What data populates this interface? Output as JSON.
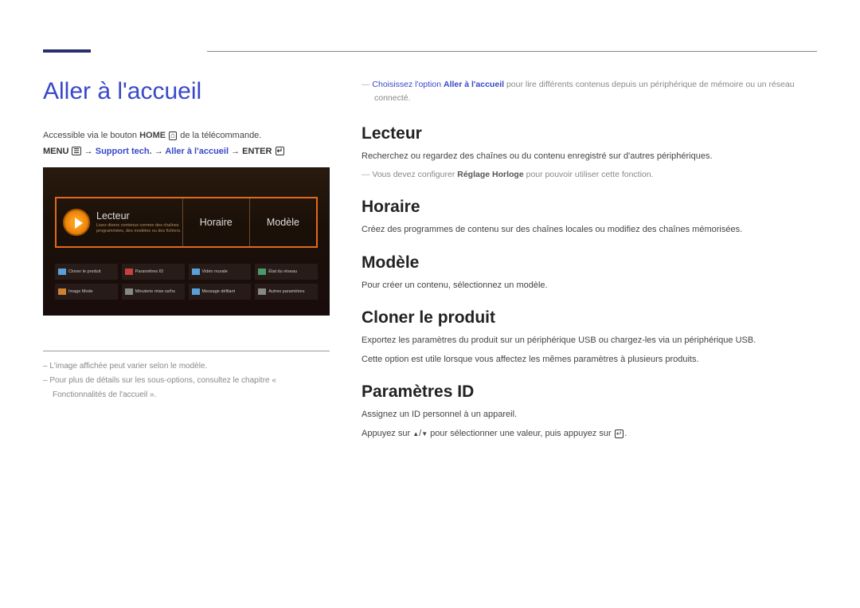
{
  "page": {
    "title": "Aller à l'accueil",
    "accessible_text_pre": "Accessible via le bouton ",
    "accessible_text_home": "HOME",
    "accessible_text_post": " de la télécommande.",
    "menu_path": {
      "menu": "MENU",
      "p2": "Support tech.",
      "p3": "Aller à l'accueil",
      "enter": "ENTER"
    }
  },
  "tv": {
    "lecteur": "Lecteur",
    "lecteur_sub": "Lisez divers contenus comme des chaînes programmées, des modèles ou des fichiers.",
    "horaire": "Horaire",
    "modele": "Modèle",
    "row2": [
      "Cloner le produit",
      "Paramètres ID",
      "Vidéo murale",
      "État du réseau"
    ],
    "row3": [
      "Image Mode",
      "Minuterie mise ss/hs",
      "Message défilant",
      "Autres paramètres"
    ]
  },
  "footnotes": {
    "f1": "L'image affichée peut varier selon le modèle.",
    "f2": "Pour plus de détails sur les sous-options, consultez le chapitre « Fonctionnalités de l'accueil »."
  },
  "right": {
    "intro_pre": "Choisissez l'option ",
    "intro_bold": "Aller à l'accueil",
    "intro_post": " pour lire différents contenus depuis un périphérique de mémoire ou un réseau connecté.",
    "lecteur": {
      "h": "Lecteur",
      "p": "Recherchez ou regardez des chaînes ou du contenu enregistré sur d'autres périphériques.",
      "note_pre": "Vous devez configurer ",
      "note_bold": "Réglage Horloge",
      "note_post": " pour pouvoir utiliser cette fonction."
    },
    "horaire": {
      "h": "Horaire",
      "p": "Créez des programmes de contenu sur des chaînes locales ou modifiez des chaînes mémorisées."
    },
    "modele": {
      "h": "Modèle",
      "p": "Pour créer un contenu, sélectionnez un modèle."
    },
    "cloner": {
      "h": "Cloner le produit",
      "p1": "Exportez les paramètres du produit sur un périphérique USB ou chargez-les via un périphérique USB.",
      "p2": "Cette option est utile lorsque vous affectez les mêmes paramètres à plusieurs produits."
    },
    "param_id": {
      "h": "Paramètres ID",
      "p1": "Assignez un ID personnel à un appareil.",
      "p2_pre": "Appuyez sur ",
      "p2_mid": " pour sélectionner une valeur, puis appuyez sur "
    }
  }
}
